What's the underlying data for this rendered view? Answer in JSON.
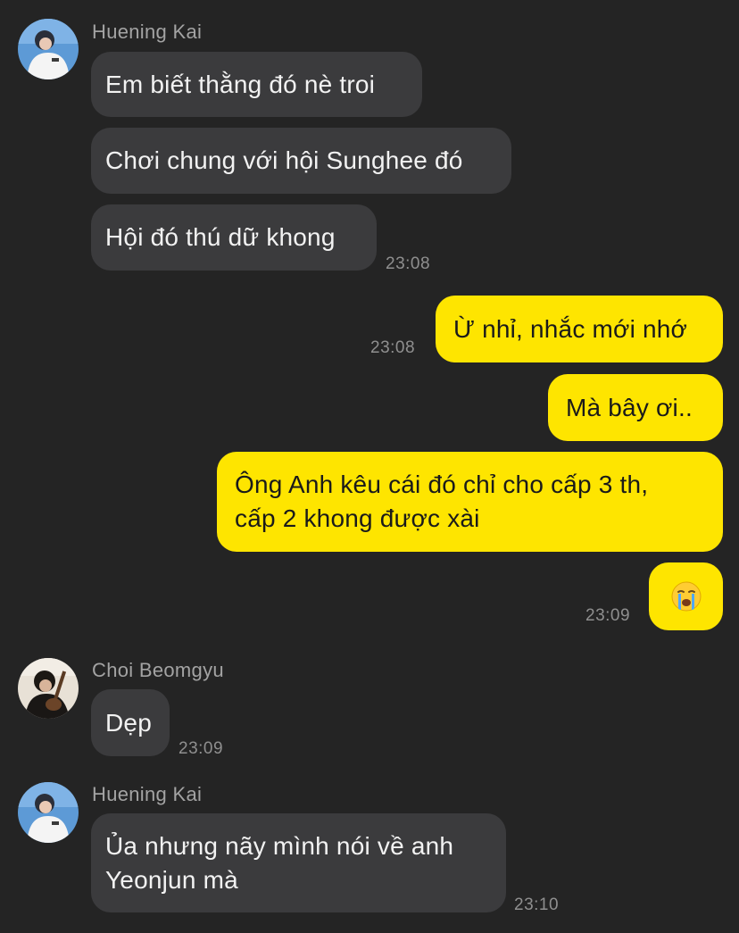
{
  "conversation": {
    "groups": [
      {
        "sender": "Huening Kai",
        "messages": [
          "Em biết thằng đó nè troi",
          "Chơi chung với hội Sunghee đó",
          "Hội đó thú dữ khong"
        ],
        "time": "23:08"
      },
      {
        "sender": "me",
        "messages": [
          "Ừ nhỉ, nhắc mới nhớ"
        ],
        "time": "23:08"
      },
      {
        "sender": "me",
        "messages": [
          "Mà bây ơi..",
          "Ông Anh kêu cái đó chỉ cho cấp 3 th,\ncấp 2 khong được xài",
          "crying-emoji"
        ],
        "lines": [
          "Ông Anh kêu cái đó chỉ cho cấp 3 th,",
          "cấp 2 khong được xài"
        ],
        "time": "23:09"
      },
      {
        "sender": "Choi Beomgyu",
        "messages": [
          "Dẹp"
        ],
        "time": "23:09"
      },
      {
        "sender": "Huening Kai",
        "messages": [
          "Ủa nhưng nãy mình nói về anh\nYeonjun mà"
        ],
        "lines": [
          "Ủa nhưng nãy mình nói về anh",
          "Yeonjun mà"
        ],
        "time": "23:10"
      }
    ]
  },
  "theme": {
    "background": "#242424",
    "incoming_bubble": "#3b3b3d",
    "outgoing_bubble": "#fee500",
    "timestamp_color": "#8f8f8f",
    "sender_name_color": "#a3a3a3"
  }
}
